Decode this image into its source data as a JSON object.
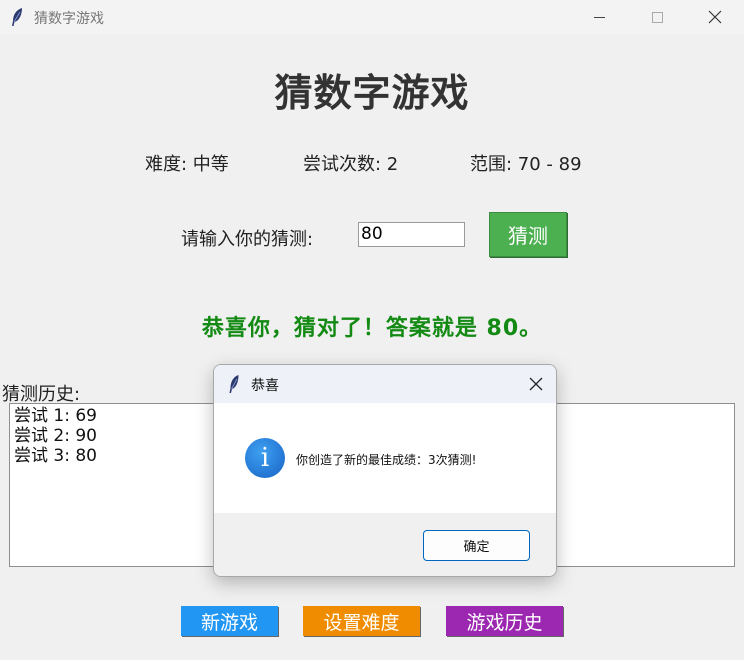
{
  "window": {
    "title": "猜数字游戏"
  },
  "heading": "猜数字游戏",
  "info": {
    "difficulty": "难度: 中等",
    "attempts": "尝试次数: 2",
    "range": "范围: 70 - 89"
  },
  "input_row": {
    "prompt": "请输入你的猜测:",
    "value": "80",
    "guess_button": "猜测"
  },
  "result_message": "恭喜你，猜对了！答案就是 80。",
  "history": {
    "label": "猜测历史:",
    "entries": [
      "尝试 1: 69",
      "尝试 2: 90",
      "尝试 3: 80"
    ]
  },
  "buttons": {
    "new_game": "新游戏",
    "set_difficulty": "设置难度",
    "game_history": "游戏历史"
  },
  "dialog": {
    "title": "恭喜",
    "message": "你创造了新的最佳成绩：3次猜测!",
    "ok": "确定",
    "icon": "info-icon"
  },
  "colors": {
    "guess_button": "#4caf50",
    "result_text": "#138a13",
    "new_game": "#2196f3",
    "set_difficulty": "#ef8c00",
    "game_history": "#9c27b0"
  }
}
